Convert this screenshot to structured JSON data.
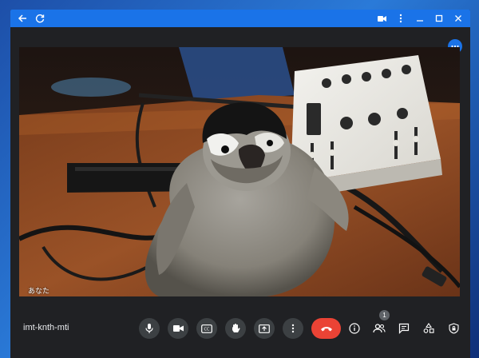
{
  "meeting": {
    "code": "imt-knth-mti",
    "self_label": "あなた",
    "participant_count": "1"
  },
  "titlebar": {
    "icons": [
      "back-icon",
      "reload-icon",
      "camera-status-icon",
      "more-vert-icon",
      "minimize-icon",
      "maximize-icon",
      "close-icon"
    ]
  },
  "controls": {
    "icons": [
      "mic-icon",
      "camera-icon",
      "captions-icon",
      "raise-hand-icon",
      "present-icon",
      "more-icon",
      "hangup-icon"
    ]
  },
  "right_controls": {
    "icons": [
      "info-icon",
      "people-icon",
      "chat-icon",
      "activities-icon",
      "host-controls-icon"
    ]
  },
  "colors": {
    "titlebar": "#1a73e8",
    "background": "#202124",
    "button": "#3c4043",
    "hangup": "#ea4335"
  }
}
